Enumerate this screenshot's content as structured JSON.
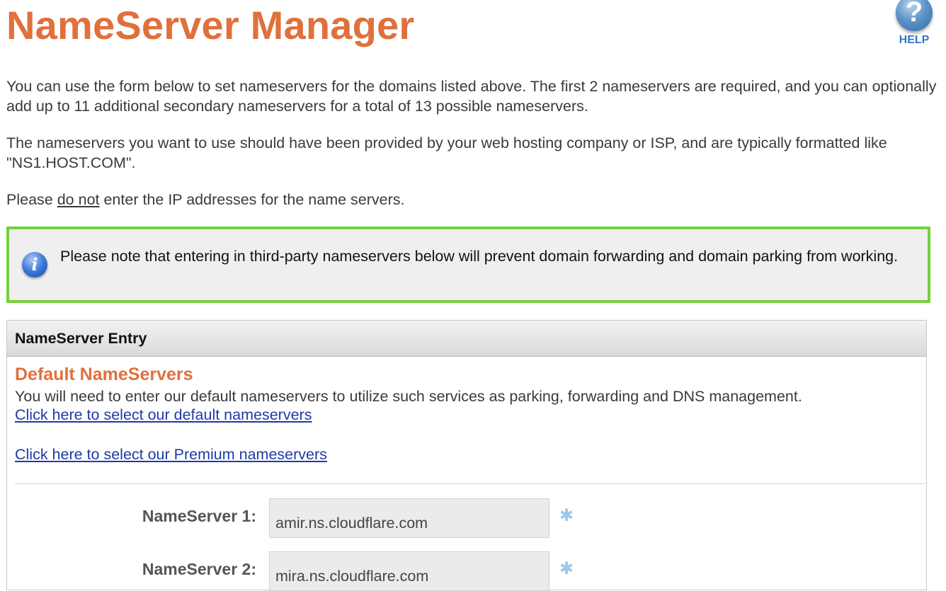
{
  "header": {
    "title": "NameServer Manager",
    "help_label": "HELP",
    "help_icon_glyph": "?"
  },
  "intro": {
    "p1": "You can use the form below to set nameservers for the domains listed above. The first 2 nameservers are required, and you can optionally add up to 11 additional secondary nameservers for a total of 13 possible nameservers.",
    "p2": "The nameservers you want to use should have been provided by your web hosting company or ISP, and are typically formatted like \"NS1.HOST.COM\".",
    "p3_before": "Please ",
    "p3_emph": "do not",
    "p3_after": " enter the IP addresses for the name servers."
  },
  "note": {
    "icon_glyph": "i",
    "text": "Please note that entering in third-party nameservers below will prevent domain forwarding and domain parking from working.",
    "border_color": "#74d13c"
  },
  "panel": {
    "header": "NameServer Entry",
    "section_title": "Default NameServers",
    "section_desc": "You will need to enter our default nameservers to utilize such services as parking, forwarding and DNS management.",
    "link_default": "Click here to select our default nameservers",
    "link_premium": "Click here to select our Premium nameservers"
  },
  "nameservers": [
    {
      "label": "NameServer 1:",
      "value": "amir.ns.cloudflare.com",
      "required_mark": "✱"
    },
    {
      "label": "NameServer 2:",
      "value": "mira.ns.cloudflare.com",
      "required_mark": "✱"
    }
  ],
  "colors": {
    "accent": "#e0703c",
    "link": "#1f3aa6",
    "help": "#2f78c4"
  }
}
